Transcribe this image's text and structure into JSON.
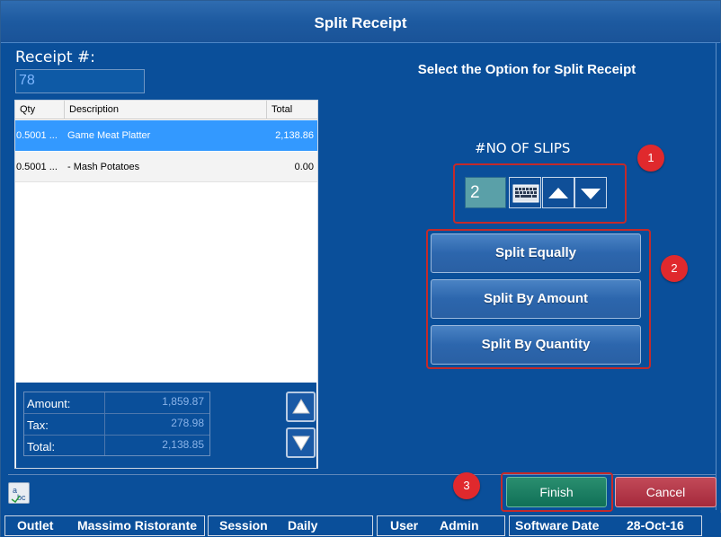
{
  "window": {
    "title": "Split Receipt"
  },
  "receipt": {
    "label": "Receipt #:",
    "number": "78"
  },
  "grid": {
    "columns": [
      "Qty",
      "Description",
      "Total"
    ],
    "rows": [
      {
        "qty": "0.5001 ...",
        "description": "Game Meat Platter",
        "total": "2,138.86",
        "selected": true
      },
      {
        "qty": "0.5001 ...",
        "description": "- Mash Potatoes",
        "total": "0.00",
        "selected": false
      }
    ]
  },
  "summary": {
    "amount_label": "Amount:",
    "amount_value": "1,859.87",
    "tax_label": "Tax:",
    "tax_value": "278.98",
    "total_label": "Total:",
    "total_value": "2,138.85"
  },
  "options": {
    "title": "Select the Option for Split Receipt",
    "slips_label": "#NO OF SLIPS",
    "slips_value": "2",
    "split_equally": "Split Equally",
    "split_by_amount": "Split By Amount",
    "split_by_quantity": "Split By Quantity"
  },
  "badges": {
    "one": "1",
    "two": "2",
    "three": "3"
  },
  "footer": {
    "finish": "Finish",
    "cancel": "Cancel"
  },
  "status": {
    "outlet_label": "Outlet",
    "outlet_value": "Massimo Ristorante",
    "session_label": "Session",
    "session_value": "Daily",
    "user_label": "User",
    "user_value": "Admin",
    "date_label": "Software Date",
    "date_value": "28-Oct-16"
  },
  "colors": {
    "background": "#0a4f9a",
    "selected_row": "#3399ff",
    "highlight": "#c42a2a",
    "finish": "#107057",
    "cancel": "#a52a3c"
  },
  "icons": [
    "keyboard-icon",
    "arrow-up-icon",
    "arrow-down-icon",
    "scroll-up-icon",
    "scroll-down-icon",
    "spellcheck-icon"
  ]
}
